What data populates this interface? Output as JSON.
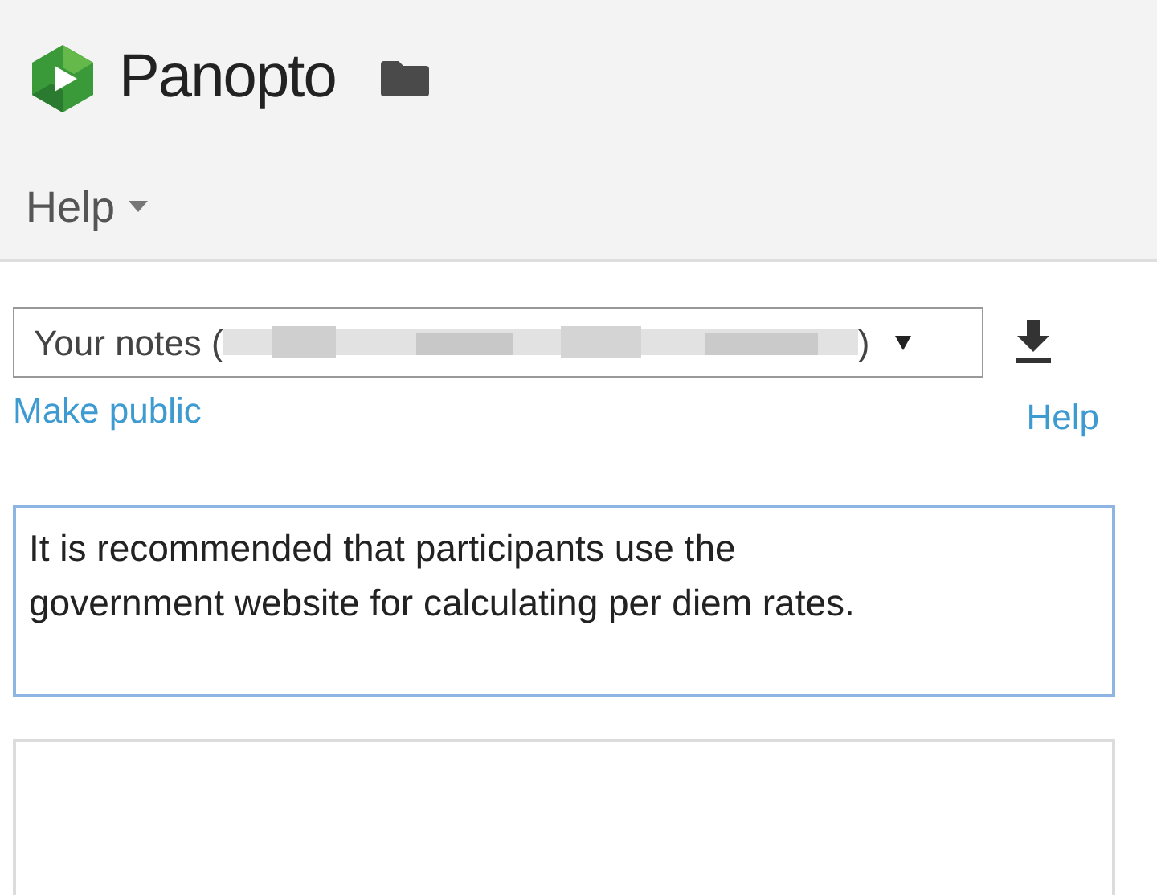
{
  "header": {
    "logo_text": "Panopto",
    "menu": {
      "label": "Help"
    }
  },
  "notes": {
    "selector": {
      "prefix": "Your notes (",
      "suffix": ")",
      "redacted": true
    },
    "make_public_link": "Make public",
    "help_link": "Help",
    "editor": {
      "value": "It is recommended that participants use the government website for calculating per diem rates.",
      "focused": true
    },
    "next_note": {
      "focused": false
    }
  }
}
